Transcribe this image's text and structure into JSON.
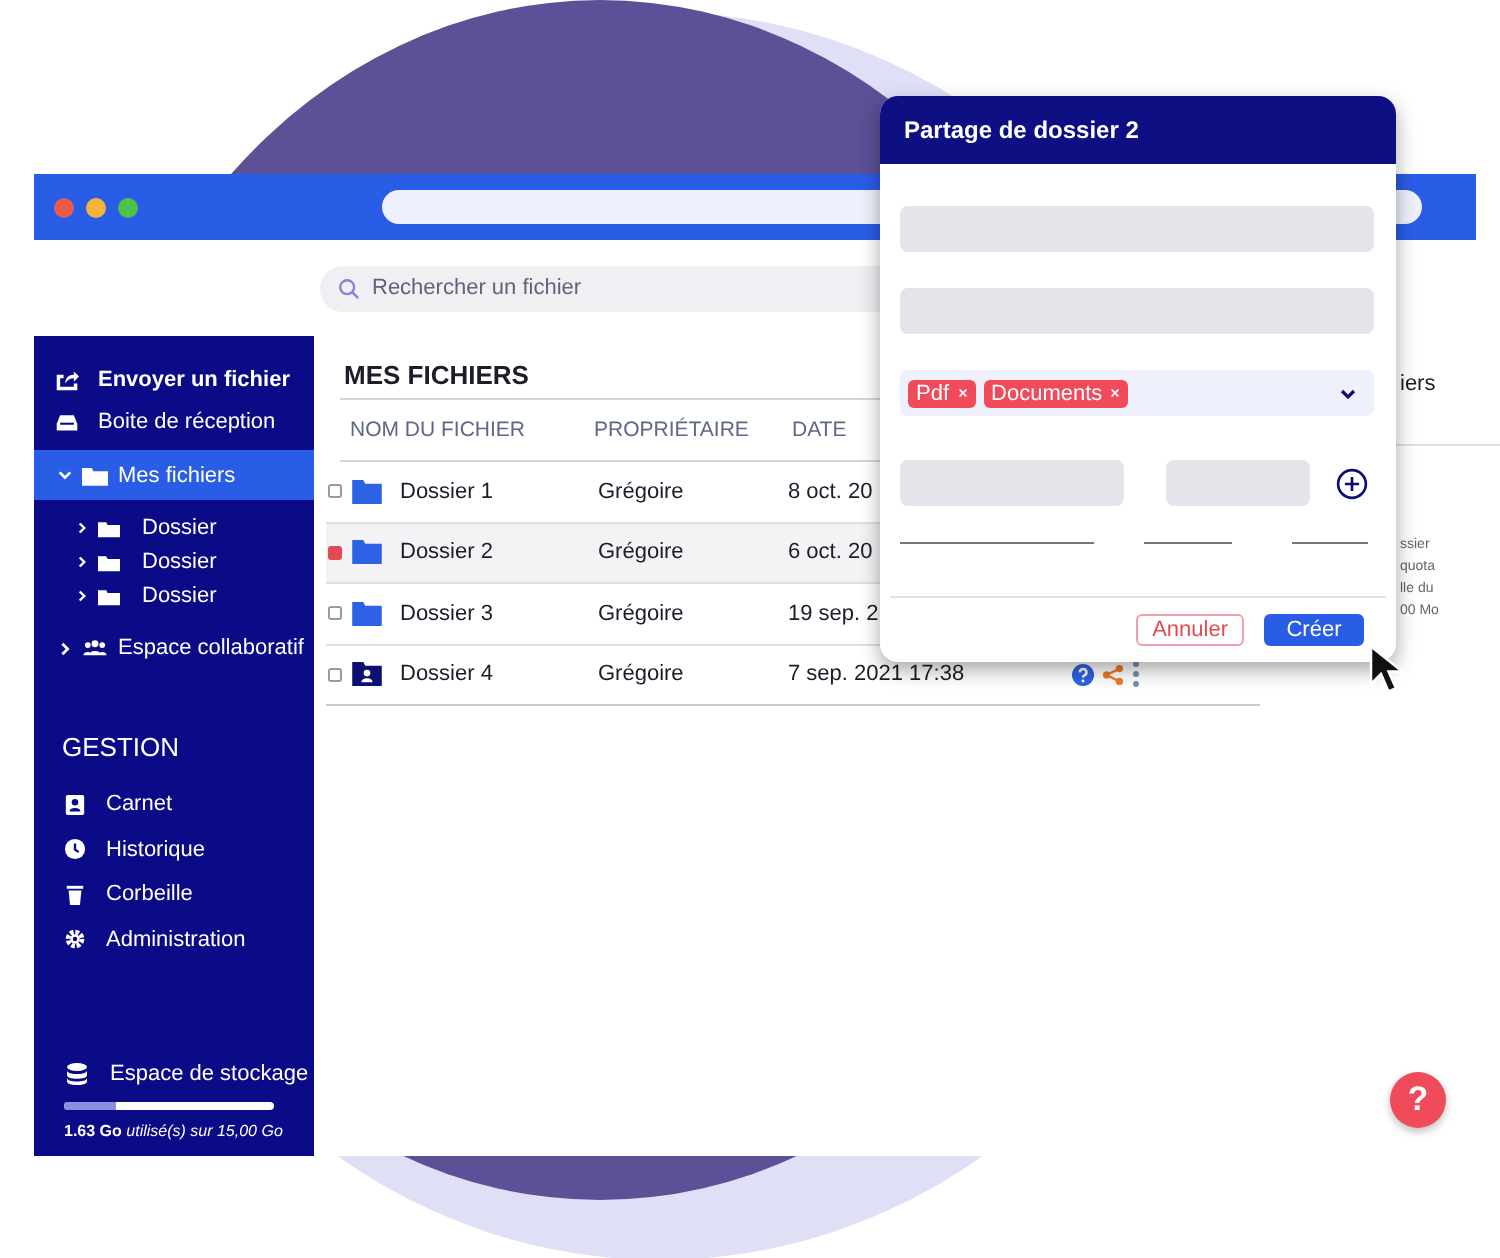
{
  "window": {
    "dots": [
      {
        "color": "#ec5a4f"
      },
      {
        "color": "#f4b63a"
      },
      {
        "color": "#4ec34c"
      }
    ]
  },
  "search": {
    "placeholder": "Rechercher un fichier"
  },
  "sidebar": {
    "top": [
      {
        "label": "Envoyer un fichier",
        "bold": true
      },
      {
        "label": "Boite de réception",
        "bold": false
      }
    ],
    "folders": {
      "label": "Mes fichiers",
      "selected": true,
      "expanded": true,
      "children": [
        {
          "label": "Dossier",
          "expanded": false
        },
        {
          "label": "Dossier",
          "expanded": false
        },
        {
          "label": "Dossier",
          "expanded": false
        }
      ]
    },
    "collab": {
      "label": "Espace collaboratif",
      "expanded": false
    },
    "section_title": "GESTION",
    "management": [
      {
        "label": "Carnet"
      },
      {
        "label": "Historique"
      },
      {
        "label": "Corbeille"
      },
      {
        "label": "Administration"
      }
    ],
    "storage": {
      "label": "Espace de stockage",
      "level": 0.25,
      "usage": "**1.63 Go** *utilisé(s) sur 15,00 Go*"
    }
  },
  "files": {
    "title": "MES FICHIERS",
    "columns": [
      "NOM DU FICHIER",
      "PROPRIÉTAIRE",
      "DATE"
    ],
    "rows": [
      {
        "name": "Dossier 1",
        "owner": "Grégoire",
        "date": "8 oct. 20",
        "selected": false,
        "shared": false
      },
      {
        "name": "Dossier 2",
        "owner": "Grégoire",
        "date": "6 oct. 20",
        "selected": true,
        "shared": false
      },
      {
        "name": "Dossier 3",
        "owner": "Grégoire",
        "date": "19 sep. 2",
        "selected": false,
        "shared": false
      },
      {
        "name": "Dossier 4",
        "owner": "Grégoire",
        "date": "7 sep. 2021 17:38",
        "selected": false,
        "shared": true,
        "actions_visible": true
      }
    ]
  },
  "side_panel": {
    "heading": "iers",
    "lines": [
      "ssier",
      "quota",
      "lle du",
      "00 Mo"
    ]
  },
  "modal": {
    "title": "Partage de dossier 2",
    "tags": [
      {
        "label": "Pdf"
      },
      {
        "label": "Documents"
      }
    ],
    "buttons": [
      {
        "kind": "secondary",
        "label": "Annuler"
      },
      {
        "kind": "primary",
        "label": "Créer"
      }
    ]
  },
  "help_button": {
    "label": "?"
  }
}
